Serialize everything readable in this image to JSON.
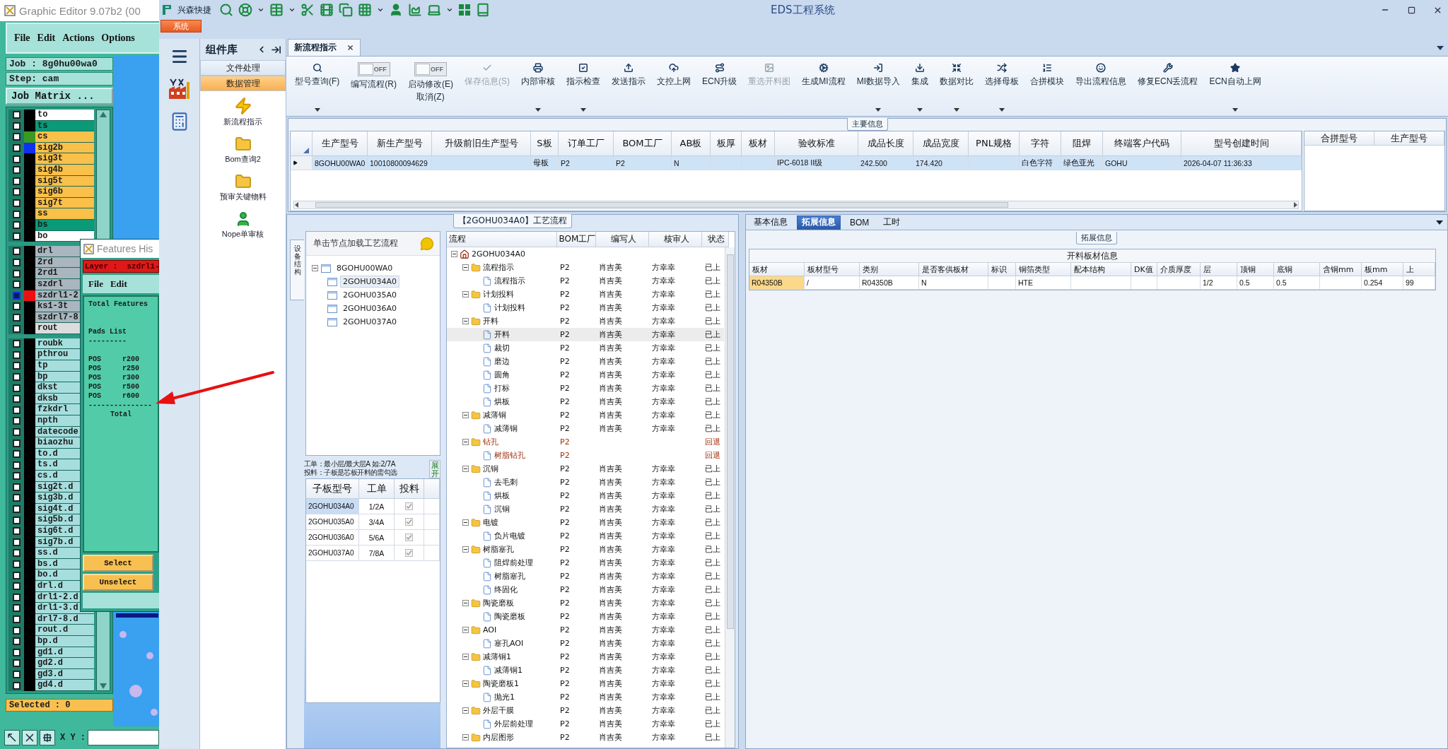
{
  "editor": {
    "title": "Graphic Editor 9.07b2 (00",
    "menu": [
      "File",
      "Edit",
      "Actions",
      "Options"
    ],
    "job": "Job : 8g0hu00wa0",
    "step": "Step: cam",
    "matrix_button": "Job Matrix ...",
    "layer_groups": [
      [
        {
          "name": "to",
          "kind": "silk",
          "selected": false
        },
        {
          "name": "ts",
          "kind": "mask",
          "selected": false
        },
        {
          "name": "cs",
          "kind": "signal",
          "color": "#3a9a20",
          "selected": false
        },
        {
          "name": "sig2b",
          "kind": "signal",
          "color": "#1030f0",
          "selected": false
        },
        {
          "name": "sig3t",
          "kind": "signal",
          "selected": false
        },
        {
          "name": "sig4b",
          "kind": "signal",
          "selected": false
        },
        {
          "name": "sig5t",
          "kind": "signal",
          "selected": false
        },
        {
          "name": "sig6b",
          "kind": "signal",
          "selected": false
        },
        {
          "name": "sig7t",
          "kind": "signal",
          "selected": false
        },
        {
          "name": "ss",
          "kind": "signal",
          "selected": false
        },
        {
          "name": "bs",
          "kind": "mask",
          "selected": false
        },
        {
          "name": "bo",
          "kind": "silk",
          "selected": false
        }
      ],
      [
        {
          "name": "drl",
          "kind": "drill",
          "selected": false
        },
        {
          "name": "2rd",
          "kind": "drill",
          "selected": false
        },
        {
          "name": "2rd1",
          "kind": "drill",
          "selected": false
        },
        {
          "name": "szdrl",
          "kind": "drill",
          "selected": false
        },
        {
          "name": "szdrl1-2",
          "kind": "drill",
          "color": "#ee1010",
          "selected": true
        },
        {
          "name": "ks1-3t",
          "kind": "drill",
          "selected": false
        },
        {
          "name": "szdrl7-8",
          "kind": "drill",
          "selected": false
        },
        {
          "name": "rout",
          "kind": "rout",
          "selected": false
        }
      ],
      [
        {
          "name": "roubk",
          "kind": "doc",
          "selected": false
        },
        {
          "name": "pthrou",
          "kind": "doc",
          "selected": false
        },
        {
          "name": "tp",
          "kind": "doc",
          "selected": false
        },
        {
          "name": "bp",
          "kind": "doc",
          "selected": false
        },
        {
          "name": "dkst",
          "kind": "doc",
          "selected": false
        },
        {
          "name": "dksb",
          "kind": "doc",
          "selected": false
        },
        {
          "name": "fzkdrl",
          "kind": "doc",
          "selected": false
        },
        {
          "name": "npth",
          "kind": "doc",
          "selected": false
        },
        {
          "name": "datecode",
          "kind": "doc",
          "selected": false
        },
        {
          "name": "biaozhu",
          "kind": "doc",
          "selected": false
        },
        {
          "name": "to.d",
          "kind": "doc",
          "selected": false
        },
        {
          "name": "ts.d",
          "kind": "doc",
          "selected": false
        },
        {
          "name": "cs.d",
          "kind": "doc",
          "selected": false
        },
        {
          "name": "sig2t.d",
          "kind": "doc",
          "selected": false
        },
        {
          "name": "sig3b.d",
          "kind": "doc",
          "selected": false
        },
        {
          "name": "sig4t.d",
          "kind": "doc",
          "selected": false
        },
        {
          "name": "sig5b.d",
          "kind": "doc",
          "selected": false
        },
        {
          "name": "sig6t.d",
          "kind": "doc",
          "selected": false
        },
        {
          "name": "sig7b.d",
          "kind": "doc",
          "selected": false
        },
        {
          "name": "ss.d",
          "kind": "doc",
          "selected": false
        },
        {
          "name": "bs.d",
          "kind": "doc",
          "selected": false
        },
        {
          "name": "bo.d",
          "kind": "doc",
          "selected": false
        },
        {
          "name": "drl.d",
          "kind": "doc",
          "selected": false
        },
        {
          "name": "drl1-2.d",
          "kind": "doc",
          "selected": false
        },
        {
          "name": "drl1-3.d",
          "kind": "doc",
          "selected": false
        },
        {
          "name": "drl7-8.d",
          "kind": "doc",
          "selected": false
        },
        {
          "name": "rout.d",
          "kind": "doc",
          "selected": false
        },
        {
          "name": "bp.d",
          "kind": "doc",
          "selected": false
        },
        {
          "name": "gd1.d",
          "kind": "doc",
          "selected": false
        },
        {
          "name": "gd2.d",
          "kind": "doc",
          "selected": false
        },
        {
          "name": "gd3.d",
          "kind": "doc",
          "selected": false
        },
        {
          "name": "gd4.d",
          "kind": "doc",
          "selected": false
        }
      ]
    ],
    "selected_count": "Selected : 0",
    "coord_label": "X Y :"
  },
  "histogram": {
    "title": "Features His",
    "layer": "Layer :  szdrl1-",
    "menu": [
      "File",
      "Edit"
    ],
    "total_title": "Total Features",
    "pads_title": "Pads List",
    "pads_rule": "---------",
    "pads": [
      {
        "type": "POS",
        "symbol": "r200"
      },
      {
        "type": "POS",
        "symbol": "r250"
      },
      {
        "type": "POS",
        "symbol": "r300"
      },
      {
        "type": "POS",
        "symbol": "r500"
      },
      {
        "type": "POS",
        "symbol": "r600"
      }
    ],
    "total_rule": "---------------",
    "total_label": "Total",
    "buttons": [
      "Select",
      "Unselect"
    ]
  },
  "app": {
    "brand": "兴森快捷",
    "title": "EDS工程系统",
    "menu_tab": "系统"
  },
  "sidebar": {
    "title": "组件库",
    "sections": [
      {
        "label": "文件处理",
        "selected": false
      },
      {
        "label": "数据管理",
        "selected": true
      }
    ],
    "items": [
      {
        "label": "新流程指示"
      },
      {
        "label": "Bom查询2"
      },
      {
        "label": "预审关键物料"
      },
      {
        "label": "Nope单审核"
      }
    ]
  },
  "document_tab": {
    "label": "新流程指示",
    "selected": true
  },
  "ribbon": [
    {
      "kind": "button",
      "label": "型号查询(F)",
      "dropdown": true,
      "disabled": false
    },
    {
      "kind": "toggle",
      "label": "编写流程(R)",
      "switch_text": "OFF",
      "on": false
    },
    {
      "kind": "toggle",
      "label": "启动修改(E)",
      "sublabel": "取消(Z)",
      "switch_text": "OFF",
      "on": false
    },
    {
      "kind": "button",
      "label": "保存信息(S)",
      "dropdown": false,
      "disabled": true
    },
    {
      "kind": "button",
      "label": "内部审核",
      "dropdown": true,
      "disabled": false
    },
    {
      "kind": "button",
      "label": "指示检查",
      "dropdown": true,
      "disabled": false
    },
    {
      "kind": "button",
      "label": "发送指示",
      "dropdown": false,
      "disabled": false
    },
    {
      "kind": "button",
      "label": "文控上网",
      "dropdown": false,
      "disabled": false
    },
    {
      "kind": "button",
      "label": "ECN升级",
      "dropdown": false,
      "disabled": false
    },
    {
      "kind": "button",
      "label": "重选开料图",
      "dropdown": false,
      "disabled": true
    },
    {
      "kind": "button",
      "label": "生成MI流程",
      "dropdown": false,
      "disabled": false
    },
    {
      "kind": "button",
      "label": "MI数据导入",
      "dropdown": true,
      "disabled": false
    },
    {
      "kind": "button",
      "label": "集成",
      "dropdown": true,
      "disabled": false
    },
    {
      "kind": "button",
      "label": "数据对比",
      "dropdown": true,
      "disabled": false
    },
    {
      "kind": "button",
      "label": "选择母板",
      "dropdown": true,
      "disabled": false
    },
    {
      "kind": "button",
      "label": "合拼模块",
      "dropdown": false,
      "disabled": false
    },
    {
      "kind": "button",
      "label": "导出流程信息",
      "dropdown": false,
      "disabled": false
    },
    {
      "kind": "button",
      "label": "修复ECN丢流程",
      "dropdown": false,
      "disabled": false
    },
    {
      "kind": "button",
      "label": "ECN自动上网",
      "dropdown": true,
      "disabled": false
    }
  ],
  "main_info": {
    "title": "主要信息",
    "columns": [
      "生产型号",
      "新生产型号",
      "升级前旧生产型号",
      "S板",
      "订单工厂",
      "BOM工厂",
      "AB板",
      "板厚",
      "板材",
      "验收标准",
      "成品长度",
      "成品宽度",
      "PNL规格",
      "字符",
      "阻焊",
      "终端客户代码",
      "型号创建时间"
    ],
    "rows": [
      {
        "selected": true,
        "cells": [
          "8GOHU00WA0",
          "10010800094629",
          "",
          "母板",
          "P2",
          "P2",
          "N",
          "",
          "",
          "IPC-6018 II级",
          "242.500",
          "174.420",
          "",
          "白色字符",
          "绿色亚光",
          "GOHU",
          "2026-04-07 11:36:33"
        ]
      }
    ],
    "side_columns": [
      "合拼型号",
      "生产型号"
    ]
  },
  "board_panel": {
    "vertical_tab": "设备结构",
    "hint": "单击节点加载工艺流程",
    "tree": {
      "label": "8GOHU00WA0",
      "expanded": true,
      "children": [
        {
          "label": "2GOHU034A0",
          "selected": true
        },
        {
          "label": "2GOHU035A0",
          "selected": false
        },
        {
          "label": "2GOHU036A0",
          "selected": false
        },
        {
          "label": "2GOHU037A0",
          "selected": false
        }
      ]
    },
    "notes": [
      "工单：最小层/最大层A 如:2/7A",
      "投料：子板是芯板开料的需勾选"
    ],
    "expand_button": "展开",
    "columns": [
      "子板型号",
      "工单",
      "投料"
    ],
    "rows": [
      {
        "board": "2GOHU034A0",
        "order": "1/2A",
        "checked": true,
        "selected": true
      },
      {
        "board": "2GOHU035A0",
        "order": "3/4A",
        "checked": true,
        "selected": false
      },
      {
        "board": "2GOHU036A0",
        "order": "5/6A",
        "checked": true,
        "selected": false
      },
      {
        "board": "2GOHU037A0",
        "order": "7/8A",
        "checked": true,
        "selected": false
      }
    ]
  },
  "process_flow": {
    "title": "【2GOHU034A0】工艺流程",
    "columns": [
      "流程",
      "BOM工厂",
      "编写人",
      "核审人",
      "状态"
    ],
    "root": {
      "name": "2GOHU034A0",
      "expanded": true,
      "selected": false,
      "returned": false,
      "children": [
        {
          "name": "流程指示",
          "bom": "P2",
          "writer": "肖吉美",
          "reviewer": "方幸幸",
          "status": "已上",
          "returned": false,
          "selected": false,
          "expanded": true,
          "children": [
            {
              "name": "流程指示",
              "bom": "P2",
              "writer": "肖吉美",
              "reviewer": "方幸幸",
              "status": "已上",
              "returned": false,
              "selected": false
            }
          ]
        },
        {
          "name": "计划投料",
          "bom": "P2",
          "writer": "肖吉美",
          "reviewer": "方幸幸",
          "status": "已上",
          "returned": false,
          "selected": false,
          "expanded": true,
          "children": [
            {
              "name": "计划投料",
              "bom": "P2",
              "writer": "肖吉美",
              "reviewer": "方幸幸",
              "status": "已上",
              "returned": false,
              "selected": false
            }
          ]
        },
        {
          "name": "开料",
          "bom": "P2",
          "writer": "肖吉美",
          "reviewer": "方幸幸",
          "status": "已上",
          "returned": false,
          "selected": false,
          "expanded": true,
          "children": [
            {
              "name": "开料",
              "bom": "P2",
              "writer": "肖吉美",
              "reviewer": "方幸幸",
              "status": "已上",
              "returned": false,
              "selected": true
            },
            {
              "name": "裁切",
              "bom": "P2",
              "writer": "肖吉美",
              "reviewer": "方幸幸",
              "status": "已上",
              "returned": false,
              "selected": false
            },
            {
              "name": "磨边",
              "bom": "P2",
              "writer": "肖吉美",
              "reviewer": "方幸幸",
              "status": "已上",
              "returned": false,
              "selected": false
            },
            {
              "name": "圆角",
              "bom": "P2",
              "writer": "肖吉美",
              "reviewer": "方幸幸",
              "status": "已上",
              "returned": false,
              "selected": false
            },
            {
              "name": "打标",
              "bom": "P2",
              "writer": "肖吉美",
              "reviewer": "方幸幸",
              "status": "已上",
              "returned": false,
              "selected": false
            },
            {
              "name": "烘板",
              "bom": "P2",
              "writer": "肖吉美",
              "reviewer": "方幸幸",
              "status": "已上",
              "returned": false,
              "selected": false
            }
          ]
        },
        {
          "name": "减薄铜",
          "bom": "P2",
          "writer": "肖吉美",
          "reviewer": "方幸幸",
          "status": "已上",
          "returned": false,
          "selected": false,
          "expanded": true,
          "children": [
            {
              "name": "减薄铜",
              "bom": "P2",
              "writer": "肖吉美",
              "reviewer": "方幸幸",
              "status": "已上",
              "returned": false,
              "selected": false
            }
          ]
        },
        {
          "name": "钻孔",
          "bom": "P2",
          "status": "回退",
          "returned": true,
          "selected": false,
          "expanded": true,
          "children": [
            {
              "name": "树脂钻孔",
              "bom": "P2",
              "status": "回退",
              "returned": true,
              "selected": false
            }
          ]
        },
        {
          "name": "沉铜",
          "bom": "P2",
          "writer": "肖吉美",
          "reviewer": "方幸幸",
          "status": "已上",
          "returned": false,
          "selected": false,
          "expanded": true,
          "children": [
            {
              "name": "去毛刺",
              "bom": "P2",
              "writer": "肖吉美",
              "reviewer": "方幸幸",
              "status": "已上",
              "returned": false,
              "selected": false
            },
            {
              "name": "烘板",
              "bom": "P2",
              "writer": "肖吉美",
              "reviewer": "方幸幸",
              "status": "已上",
              "returned": false,
              "selected": false
            },
            {
              "name": "沉铜",
              "bom": "P2",
              "writer": "肖吉美",
              "reviewer": "方幸幸",
              "status": "已上",
              "returned": false,
              "selected": false
            }
          ]
        },
        {
          "name": "电镀",
          "bom": "P2",
          "writer": "肖吉美",
          "reviewer": "方幸幸",
          "status": "已上",
          "returned": false,
          "selected": false,
          "expanded": true,
          "children": [
            {
              "name": "负片电镀",
              "bom": "P2",
              "writer": "肖吉美",
              "reviewer": "方幸幸",
              "status": "已上",
              "returned": false,
              "selected": false
            }
          ]
        },
        {
          "name": "树脂塞孔",
          "bom": "P2",
          "writer": "肖吉美",
          "reviewer": "方幸幸",
          "status": "已上",
          "returned": false,
          "selected": false,
          "expanded": true,
          "children": [
            {
              "name": "阻焊前处理",
              "bom": "P2",
              "writer": "肖吉美",
              "reviewer": "方幸幸",
              "status": "已上",
              "returned": false,
              "selected": false
            },
            {
              "name": "树脂塞孔",
              "bom": "P2",
              "writer": "肖吉美",
              "reviewer": "方幸幸",
              "status": "已上",
              "returned": false,
              "selected": false
            },
            {
              "name": "终固化",
              "bom": "P2",
              "writer": "肖吉美",
              "reviewer": "方幸幸",
              "status": "已上",
              "returned": false,
              "selected": false
            }
          ]
        },
        {
          "name": "陶瓷磨板",
          "bom": "P2",
          "writer": "肖吉美",
          "reviewer": "方幸幸",
          "status": "已上",
          "returned": false,
          "selected": false,
          "expanded": true,
          "children": [
            {
              "name": "陶瓷磨板",
              "bom": "P2",
              "writer": "肖吉美",
              "reviewer": "方幸幸",
              "status": "已上",
              "returned": false,
              "selected": false
            }
          ]
        },
        {
          "name": "AOI",
          "bom": "P2",
          "writer": "肖吉美",
          "reviewer": "方幸幸",
          "status": "已上",
          "returned": false,
          "selected": false,
          "expanded": true,
          "children": [
            {
              "name": "塞孔AOI",
              "bom": "P2",
              "writer": "肖吉美",
              "reviewer": "方幸幸",
              "status": "已上",
              "returned": false,
              "selected": false
            }
          ]
        },
        {
          "name": "减薄铜1",
          "bom": "P2",
          "writer": "肖吉美",
          "reviewer": "方幸幸",
          "status": "已上",
          "returned": false,
          "selected": false,
          "expanded": true,
          "children": [
            {
              "name": "减薄铜1",
              "bom": "P2",
              "writer": "肖吉美",
              "reviewer": "方幸幸",
              "status": "已上",
              "returned": false,
              "selected": false
            }
          ]
        },
        {
          "name": "陶瓷磨板1",
          "bom": "P2",
          "writer": "肖吉美",
          "reviewer": "方幸幸",
          "status": "已上",
          "returned": false,
          "selected": false,
          "expanded": true,
          "children": [
            {
              "name": "抛光1",
              "bom": "P2",
              "writer": "肖吉美",
              "reviewer": "方幸幸",
              "status": "已上",
              "returned": false,
              "selected": false
            }
          ]
        },
        {
          "name": "外层干膜",
          "bom": "P2",
          "writer": "肖吉美",
          "reviewer": "方幸幸",
          "status": "已上",
          "returned": false,
          "selected": false,
          "expanded": true,
          "children": [
            {
              "name": "外层前处理",
              "bom": "P2",
              "writer": "肖吉美",
              "reviewer": "方幸幸",
              "status": "已上",
              "returned": false,
              "selected": false
            }
          ]
        },
        {
          "name": "内层图形",
          "bom": "P2",
          "writer": "肖吉美",
          "reviewer": "方幸幸",
          "status": "已上",
          "returned": false,
          "selected": false,
          "expanded": true
        }
      ]
    }
  },
  "detail_tabs": [
    {
      "label": "基本信息",
      "selected": false
    },
    {
      "label": "拓展信息",
      "selected": true
    },
    {
      "label": "BOM",
      "selected": false
    },
    {
      "label": "工时",
      "selected": false
    }
  ],
  "extended_info": {
    "title": "拓展信息",
    "table_caption": "开料板材信息",
    "columns": [
      "板材",
      "板材型号",
      "类别",
      "是否客供板材",
      "标识",
      "铜箔类型",
      "配本结构",
      "DK值",
      "介质厚度",
      "层",
      "顶铜",
      "底铜",
      "含铜mm",
      "板mm",
      "上"
    ],
    "rows": [
      {
        "selected": true,
        "cells": [
          "R04350B",
          "/",
          "R04350B",
          "N",
          "",
          "HTE",
          "",
          "",
          "",
          "1/2",
          "0.5",
          "0.5",
          "",
          "0.254",
          "99"
        ]
      }
    ]
  }
}
